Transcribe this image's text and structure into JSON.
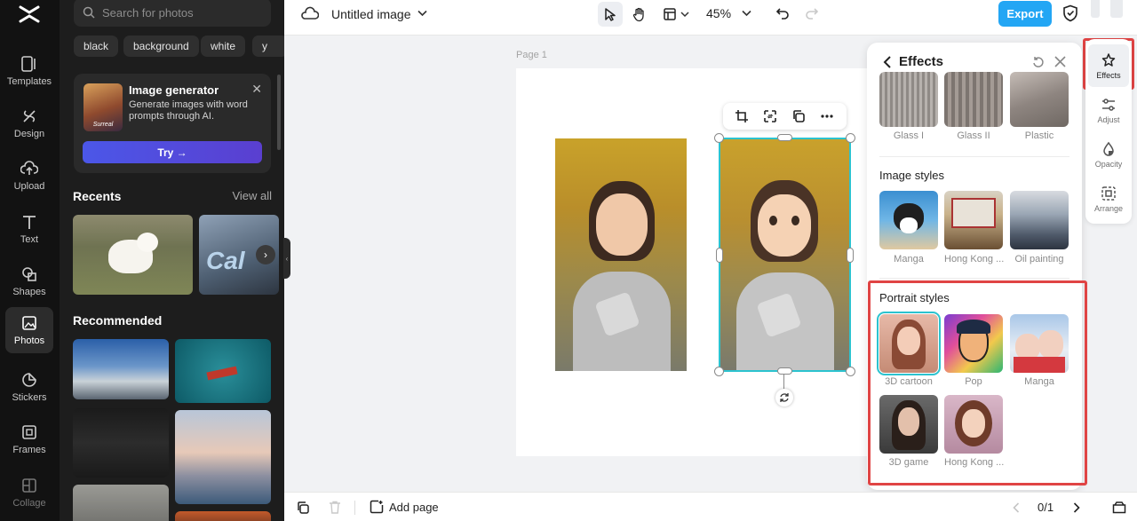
{
  "rail": {
    "items": [
      {
        "label": "Templates",
        "icon": "templates-icon"
      },
      {
        "label": "Design",
        "icon": "design-icon"
      },
      {
        "label": "Upload",
        "icon": "upload-icon"
      },
      {
        "label": "Text",
        "icon": "text-icon"
      },
      {
        "label": "Shapes",
        "icon": "shapes-icon"
      },
      {
        "label": "Photos",
        "icon": "photos-icon"
      },
      {
        "label": "Stickers",
        "icon": "stickers-icon"
      },
      {
        "label": "Frames",
        "icon": "frames-icon"
      },
      {
        "label": "Collage",
        "icon": "collage-icon"
      }
    ],
    "active": "Photos"
  },
  "panel": {
    "search_placeholder": "Search for photos",
    "chips": [
      "black",
      "background",
      "white",
      "y"
    ],
    "generator": {
      "title": "Image generator",
      "description": "Generate images with word prompts through AI.",
      "thumb_label": "Surreal",
      "try_label": "Try →"
    },
    "recents_title": "Recents",
    "view_all": "View all",
    "recommended_title": "Recommended"
  },
  "topbar": {
    "doc_title": "Untitled image",
    "zoom": "45%",
    "export_label": "Export"
  },
  "canvas": {
    "page_label": "Page 1"
  },
  "effects": {
    "title": "Effects",
    "top_row": [
      "Glass I",
      "Glass II",
      "Plastic"
    ],
    "image_styles_title": "Image styles",
    "image_styles": [
      "Manga",
      "Hong Kong ...",
      "Oil painting"
    ],
    "portrait_styles_title": "Portrait styles",
    "portrait_styles": [
      "3D cartoon",
      "Pop",
      "Manga",
      "3D game",
      "Hong Kong ..."
    ],
    "selected": "3D cartoon"
  },
  "right_tools": {
    "items": [
      "Effects",
      "Adjust",
      "Opacity",
      "Arrange"
    ],
    "active": "Effects"
  },
  "bottombar": {
    "add_page": "Add page",
    "page_count": "0/1"
  },
  "colors": {
    "accent": "#2cc3cf",
    "export": "#23a6f4",
    "highlight": "#e04444"
  }
}
